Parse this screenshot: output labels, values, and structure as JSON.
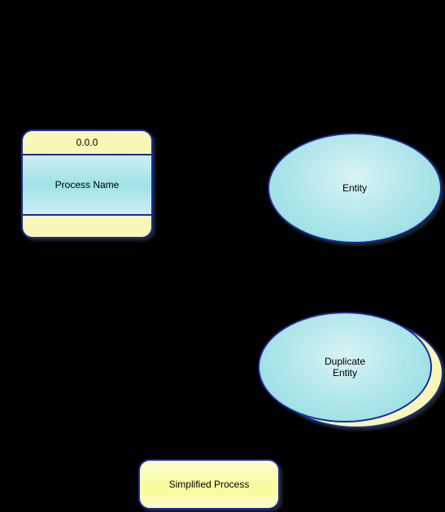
{
  "process": {
    "id": "0.0.0",
    "name": "Process Name"
  },
  "entity": {
    "label": "Entity"
  },
  "duplicate_entity": {
    "label": "Duplicate\nEntity"
  },
  "simplified_process": {
    "label": "Simplified Process"
  }
}
